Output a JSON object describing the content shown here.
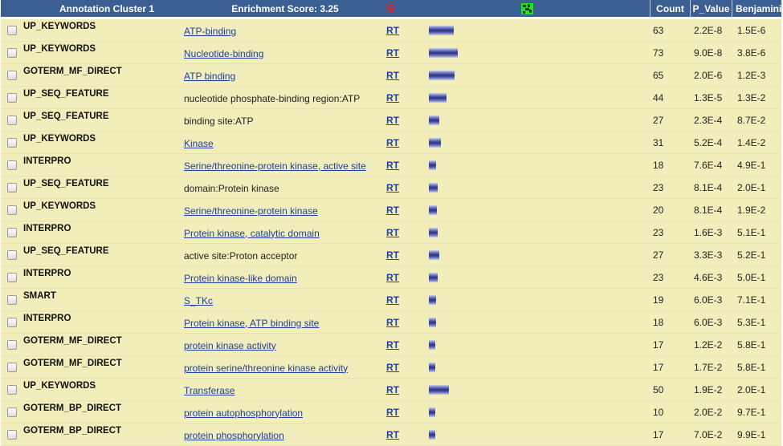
{
  "header": {
    "cluster_label": "Annotation Cluster 1",
    "enrichment_label": "Enrichment Score: 3.25",
    "g_icon": "G",
    "count_label": "Count",
    "pvalue_label": "P_Value",
    "benjamini_label": "Benjamini"
  },
  "colors": {
    "header_bg": "#3c5f93",
    "row_bg": "#f2eebb",
    "link": "#1f3f9e",
    "g_icon": "#e8201d",
    "network_icon": "#11ee11"
  },
  "rows": [
    {
      "category": "UP_KEYWORDS",
      "term": "ATP-binding",
      "link": true,
      "rt": "RT",
      "count": "63",
      "p_value": "2.2E-8",
      "benjamini": "1.5E-6",
      "bar_level": 63
    },
    {
      "category": "UP_KEYWORDS",
      "term": "Nucleotide-binding",
      "link": true,
      "rt": "RT",
      "count": "73",
      "p_value": "9.0E-8",
      "benjamini": "3.8E-6",
      "bar_level": 73
    },
    {
      "category": "GOTERM_MF_DIRECT",
      "term": "ATP binding",
      "link": true,
      "rt": "RT",
      "count": "65",
      "p_value": "2.0E-6",
      "benjamini": "1.2E-3",
      "bar_level": 65
    },
    {
      "category": "UP_SEQ_FEATURE",
      "term": "nucleotide phosphate-binding region:ATP",
      "link": false,
      "rt": "RT",
      "count": "44",
      "p_value": "1.3E-5",
      "benjamini": "1.3E-2",
      "bar_level": 44
    },
    {
      "category": "UP_SEQ_FEATURE",
      "term": "binding site:ATP",
      "link": false,
      "rt": "RT",
      "count": "27",
      "p_value": "2.3E-4",
      "benjamini": "8.7E-2",
      "bar_level": 27
    },
    {
      "category": "UP_KEYWORDS",
      "term": "Kinase",
      "link": true,
      "rt": "RT",
      "count": "31",
      "p_value": "5.2E-4",
      "benjamini": "1.4E-2",
      "bar_level": 31
    },
    {
      "category": "INTERPRO",
      "term": "Serine/threonine-protein kinase, active site",
      "link": true,
      "rt": "RT",
      "count": "18",
      "p_value": "7.6E-4",
      "benjamini": "4.9E-1",
      "bar_level": 18
    },
    {
      "category": "UP_SEQ_FEATURE",
      "term": "domain:Protein kinase",
      "link": false,
      "rt": "RT",
      "count": "23",
      "p_value": "8.1E-4",
      "benjamini": "2.0E-1",
      "bar_level": 23
    },
    {
      "category": "UP_KEYWORDS",
      "term": "Serine/threonine-protein kinase",
      "link": true,
      "rt": "RT",
      "count": "20",
      "p_value": "8.1E-4",
      "benjamini": "1.9E-2",
      "bar_level": 20
    },
    {
      "category": "INTERPRO",
      "term": "Protein kinase, catalytic domain",
      "link": true,
      "rt": "RT",
      "count": "23",
      "p_value": "1.6E-3",
      "benjamini": "5.1E-1",
      "bar_level": 23
    },
    {
      "category": "UP_SEQ_FEATURE",
      "term": "active site:Proton acceptor",
      "link": false,
      "rt": "RT",
      "count": "27",
      "p_value": "3.3E-3",
      "benjamini": "5.2E-1",
      "bar_level": 27
    },
    {
      "category": "INTERPRO",
      "term": "Protein kinase-like domain",
      "link": true,
      "rt": "RT",
      "count": "23",
      "p_value": "4.6E-3",
      "benjamini": "5.0E-1",
      "bar_level": 23
    },
    {
      "category": "SMART",
      "term": "S_TKc",
      "link": true,
      "rt": "RT",
      "count": "19",
      "p_value": "6.0E-3",
      "benjamini": "7.1E-1",
      "bar_level": 19
    },
    {
      "category": "INTERPRO",
      "term": "Protein kinase, ATP binding site",
      "link": true,
      "rt": "RT",
      "count": "18",
      "p_value": "6.0E-3",
      "benjamini": "5.3E-1",
      "bar_level": 18
    },
    {
      "category": "GOTERM_MF_DIRECT",
      "term": "protein kinase activity",
      "link": true,
      "rt": "RT",
      "count": "17",
      "p_value": "1.2E-2",
      "benjamini": "5.8E-1",
      "bar_level": 17
    },
    {
      "category": "GOTERM_MF_DIRECT",
      "term": "protein serine/threonine kinase activity",
      "link": true,
      "rt": "RT",
      "count": "17",
      "p_value": "1.7E-2",
      "benjamini": "5.8E-1",
      "bar_level": 17
    },
    {
      "category": "UP_KEYWORDS",
      "term": "Transferase",
      "link": true,
      "rt": "RT",
      "count": "50",
      "p_value": "1.9E-2",
      "benjamini": "2.0E-1",
      "bar_level": 50
    },
    {
      "category": "GOTERM_BP_DIRECT",
      "term": "protein autophosphorylation",
      "link": true,
      "rt": "RT",
      "count": "10",
      "p_value": "2.0E-2",
      "benjamini": "9.7E-1",
      "bar_level": 10
    },
    {
      "category": "GOTERM_BP_DIRECT",
      "term": "protein phosphorylation",
      "link": true,
      "rt": "RT",
      "count": "17",
      "p_value": "7.0E-2",
      "benjamini": "9.9E-1",
      "bar_level": 17
    }
  ]
}
